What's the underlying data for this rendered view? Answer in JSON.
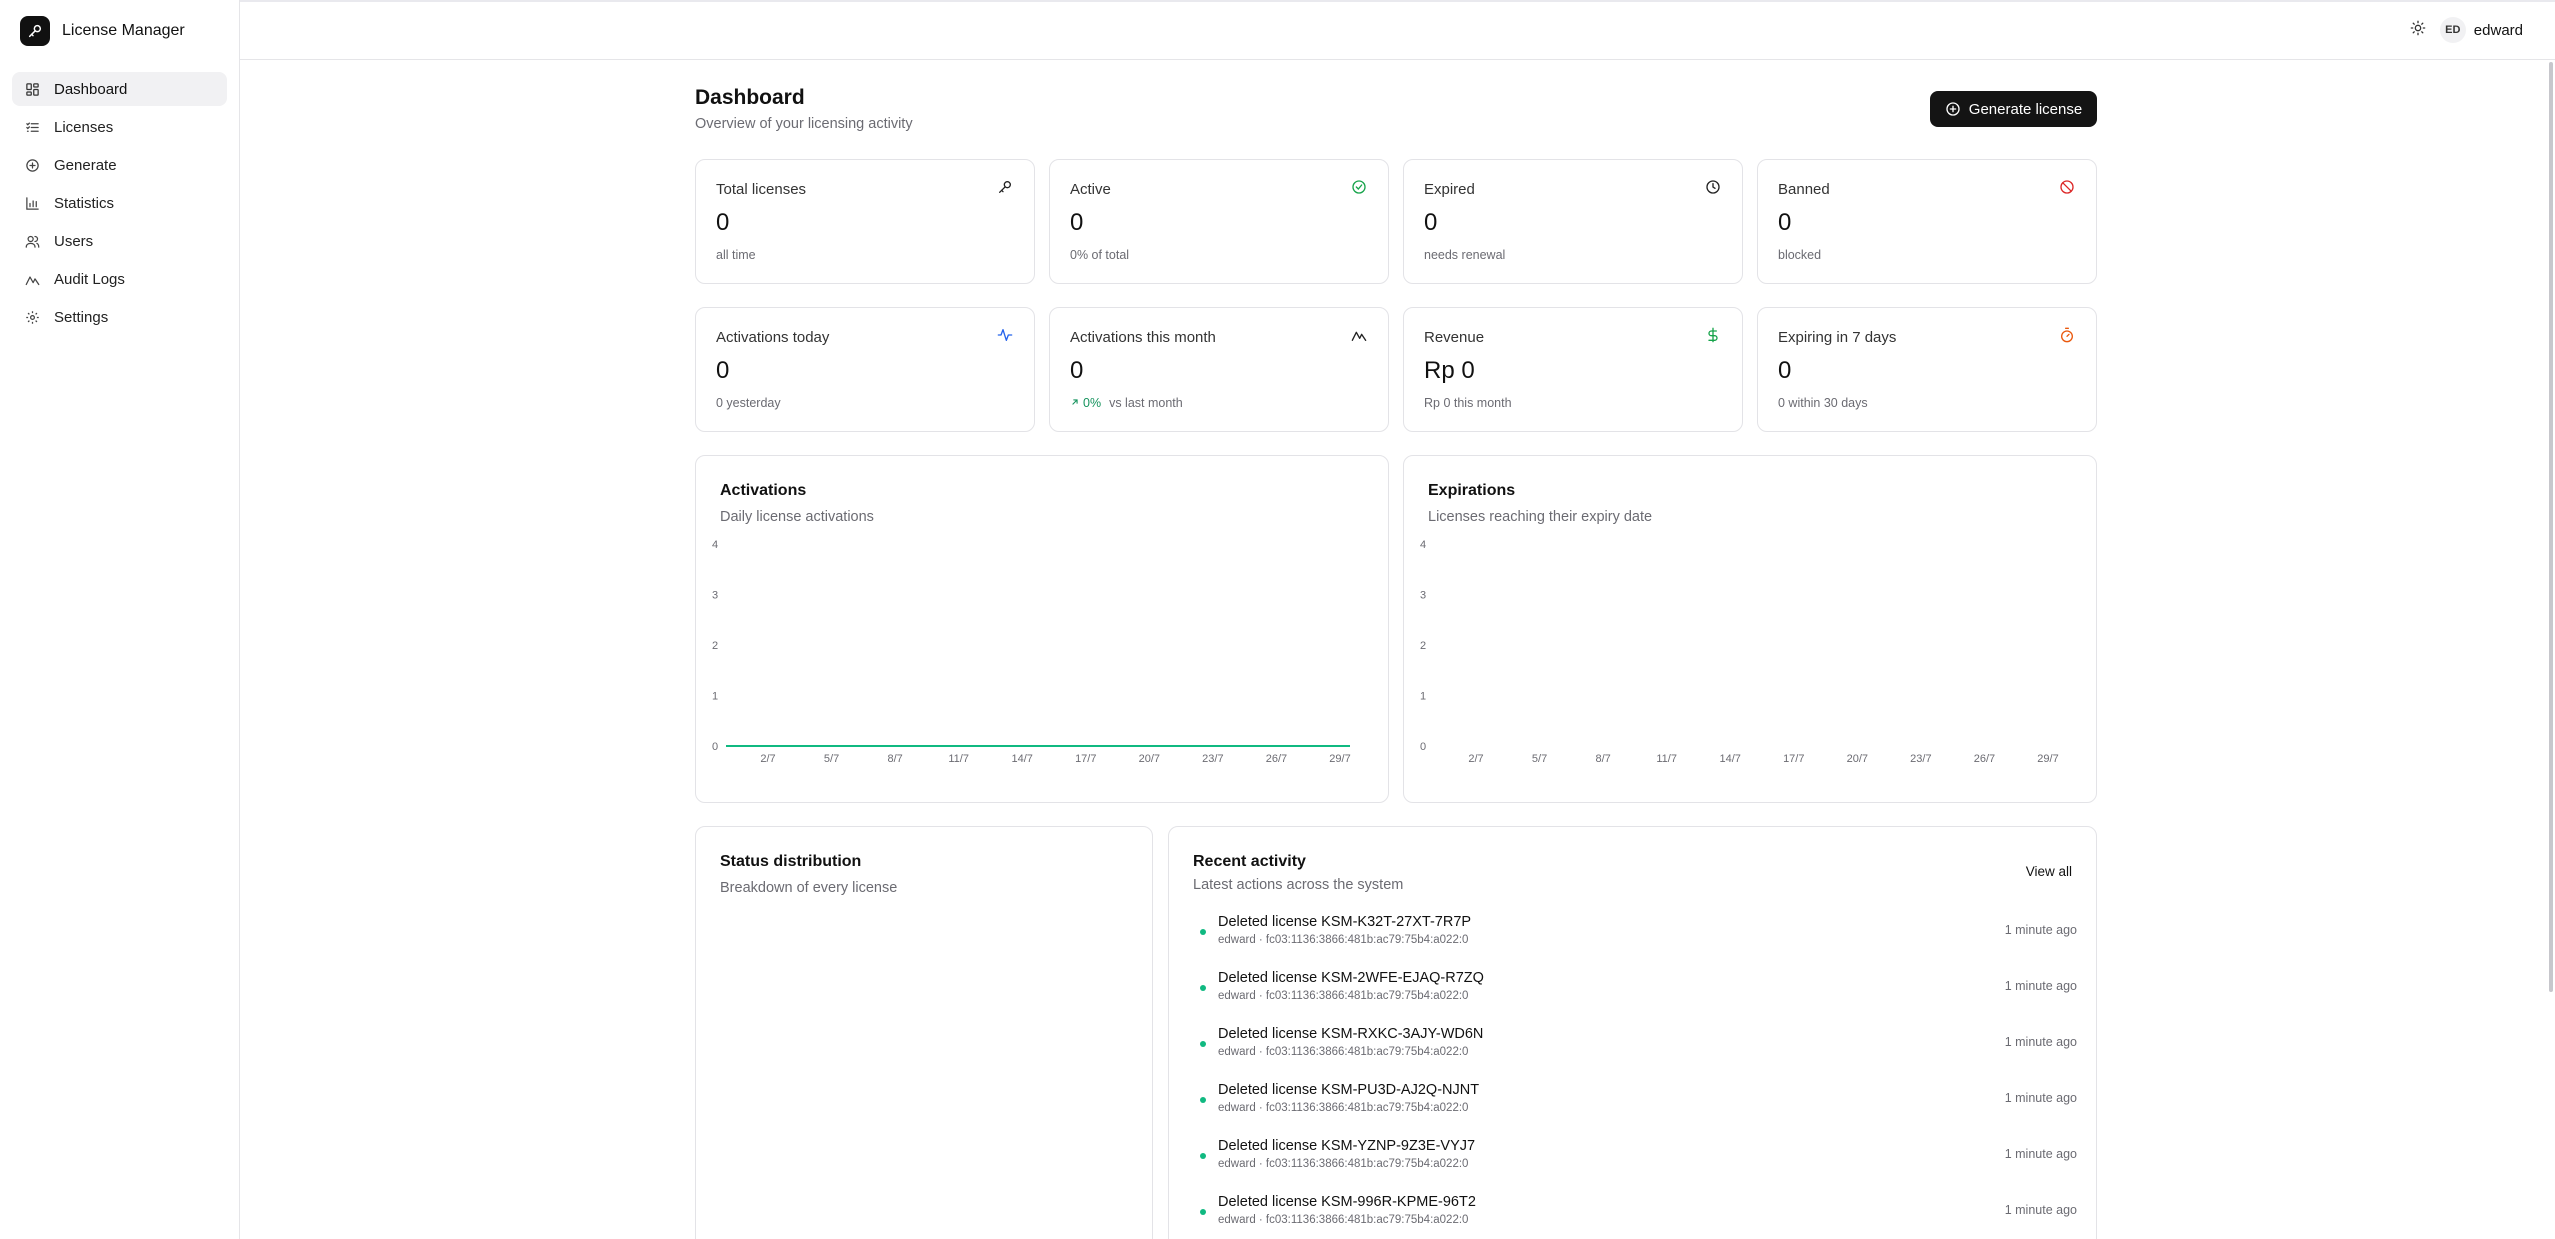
{
  "app": {
    "name": "License Manager"
  },
  "sidebar": {
    "items": [
      {
        "label": "Dashboard",
        "icon": "dashboard-grid-icon",
        "active": true
      },
      {
        "label": "Licenses",
        "icon": "list-icon",
        "active": false
      },
      {
        "label": "Generate",
        "icon": "plus-circle-icon",
        "active": false
      },
      {
        "label": "Statistics",
        "icon": "bar-chart-icon",
        "active": false
      },
      {
        "label": "Users",
        "icon": "users-icon",
        "active": false
      },
      {
        "label": "Audit Logs",
        "icon": "activity-icon",
        "active": false
      },
      {
        "label": "Settings",
        "icon": "gear-icon",
        "active": false
      }
    ]
  },
  "header": {
    "theme_icon": "sun-icon",
    "user": {
      "initials": "ED",
      "name": "edward"
    }
  },
  "page": {
    "title": "Dashboard",
    "subtitle": "Overview of your licensing activity",
    "generate_label": "Generate license"
  },
  "stats": [
    {
      "label": "Total licenses",
      "value": "0",
      "note": "all time",
      "icon": "key-icon",
      "color": "#222222"
    },
    {
      "label": "Active",
      "value": "0",
      "note": "0% of total",
      "icon": "check-circle-icon",
      "color": "#16a34a"
    },
    {
      "label": "Expired",
      "value": "0",
      "note": "needs renewal",
      "icon": "clock-icon",
      "color": "#222222"
    },
    {
      "label": "Banned",
      "value": "0",
      "note": "blocked",
      "icon": "ban-icon",
      "color": "#dc2626"
    },
    {
      "label": "Activations today",
      "value": "0",
      "note": "0 yesterday",
      "icon": "pulse-icon",
      "color": "#2563eb"
    },
    {
      "label": "Activations this month",
      "value": "0",
      "trend": "0%",
      "note": "vs last month",
      "icon": "trend-icon",
      "color": "#222222"
    },
    {
      "label": "Revenue",
      "value": "Rp 0",
      "note": "Rp 0 this month",
      "icon": "dollar-icon",
      "color": "#16a34a"
    },
    {
      "label": "Expiring in 7 days",
      "value": "0",
      "note": "0 within 30 days",
      "icon": "timer-icon",
      "color": "#ea580c"
    }
  ],
  "charts": {
    "activations": {
      "title": "Activations",
      "subtitle": "Daily license activations"
    },
    "expirations": {
      "title": "Expirations",
      "subtitle": "Licenses reaching their expiry date"
    },
    "status": {
      "title": "Status distribution",
      "subtitle": "Breakdown of every license"
    }
  },
  "chart_data": [
    {
      "type": "line",
      "title": "Activations",
      "subtitle": "Daily license activations",
      "x": [
        "2/7",
        "5/7",
        "8/7",
        "11/7",
        "14/7",
        "17/7",
        "20/7",
        "23/7",
        "26/7",
        "29/7"
      ],
      "series": [
        {
          "values": [
            0,
            0,
            0,
            0,
            0,
            0,
            0,
            0,
            0,
            0
          ],
          "color": "#10b981"
        }
      ],
      "yticks": [
        0,
        1,
        2,
        3,
        4
      ],
      "ylim": [
        0,
        4
      ],
      "xlabel": "",
      "ylabel": "",
      "grid": false
    },
    {
      "type": "line",
      "title": "Expirations",
      "subtitle": "Licenses reaching their expiry date",
      "x": [
        "2/7",
        "5/7",
        "8/7",
        "11/7",
        "14/7",
        "17/7",
        "20/7",
        "23/7",
        "26/7",
        "29/7"
      ],
      "series": [],
      "yticks": [
        0,
        1,
        2,
        3,
        4
      ],
      "ylim": [
        0,
        4
      ],
      "xlabel": "",
      "ylabel": "",
      "grid": false
    }
  ],
  "activity": {
    "title": "Recent activity",
    "subtitle": "Latest actions across the system",
    "view_all": "View all",
    "items": [
      {
        "title": "Deleted license KSM-K32T-27XT-7R7P",
        "meta": "edward · fc03:1136:3866:481b:ac79:75b4:a022:0",
        "time": "1 minute ago"
      },
      {
        "title": "Deleted license KSM-2WFE-EJAQ-R7ZQ",
        "meta": "edward · fc03:1136:3866:481b:ac79:75b4:a022:0",
        "time": "1 minute ago"
      },
      {
        "title": "Deleted license KSM-RXKC-3AJY-WD6N",
        "meta": "edward · fc03:1136:3866:481b:ac79:75b4:a022:0",
        "time": "1 minute ago"
      },
      {
        "title": "Deleted license KSM-PU3D-AJ2Q-NJNT",
        "meta": "edward · fc03:1136:3866:481b:ac79:75b4:a022:0",
        "time": "1 minute ago"
      },
      {
        "title": "Deleted license KSM-YZNP-9Z3E-VYJ7",
        "meta": "edward · fc03:1136:3866:481b:ac79:75b4:a022:0",
        "time": "1 minute ago"
      },
      {
        "title": "Deleted license KSM-996R-KPME-96T2",
        "meta": "edward · fc03:1136:3866:481b:ac79:75b4:a022:0",
        "time": "1 minute ago"
      }
    ]
  },
  "colors": {
    "accent": "#141414",
    "success": "#10b981",
    "muted": "#6b6b72"
  }
}
